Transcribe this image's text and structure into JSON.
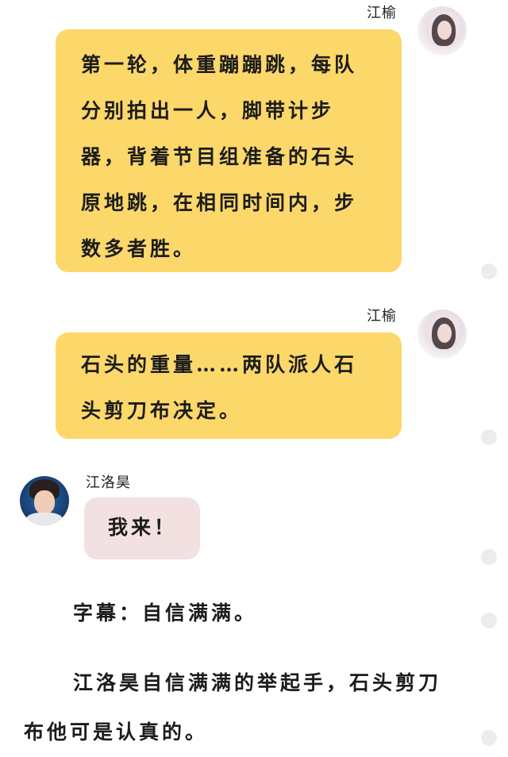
{
  "messages": [
    {
      "sender": "江榆",
      "side": "right",
      "avatar_icon": "girl-avatar-icon",
      "text_lines": [
        "第一轮，体重蹦蹦跳，每队",
        "分别拍出一人，脚带计步",
        "器，背着节目组准备的石头",
        "原地跳，在相同时间内，步",
        "数多者胜。"
      ]
    },
    {
      "sender": "江榆",
      "side": "right",
      "avatar_icon": "girl-avatar-icon",
      "text_lines": [
        "石头的重量……两队派人石",
        "头剪刀布决定。"
      ]
    },
    {
      "sender": "江洛昊",
      "side": "left",
      "avatar_icon": "boy-avatar-icon",
      "text_lines": [
        "我来！"
      ]
    }
  ],
  "narration": {
    "caption": "字幕：自信满满。",
    "paragraph_lines": [
      "江洛昊自信满满的举起手，石头剪刀",
      "布他可是认真的。"
    ]
  },
  "colors": {
    "yellow_bubble": "#fcd76a",
    "pink_bubble": "#f3e1e1",
    "scroll_dot": "#ececec"
  }
}
